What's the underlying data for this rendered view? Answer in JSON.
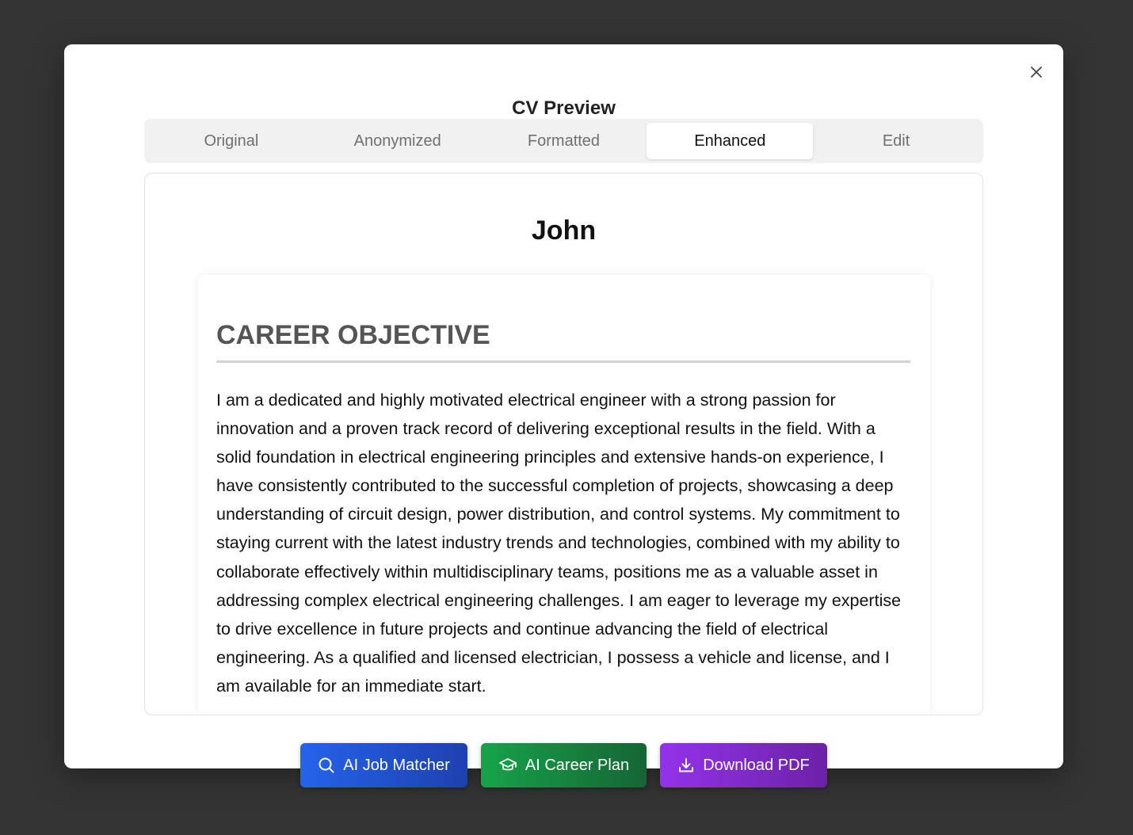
{
  "modal": {
    "title": "CV Preview",
    "close_icon": "close-icon"
  },
  "tabs": [
    {
      "label": "Original"
    },
    {
      "label": "Anonymized"
    },
    {
      "label": "Formatted"
    },
    {
      "label": "Enhanced",
      "active": true
    },
    {
      "label": "Edit"
    }
  ],
  "cv": {
    "name": "John",
    "section_title": "CAREER OBJECTIVE",
    "section_text": "I am a dedicated and highly motivated electrical engineer with a strong passion for innovation and a proven track record of delivering exceptional results in the field. With a solid foundation in electrical engineering principles and extensive hands-on experience, I have consistently contributed to the successful completion of projects, showcasing a deep understanding of circuit design, power distribution, and control systems. My commitment to staying current with the latest industry trends and technologies, combined with my ability to collaborate effectively within multidisciplinary teams, positions me as a valuable asset in addressing complex electrical engineering challenges. I am eager to leverage my expertise to drive excellence in future projects and continue advancing the field of electrical engineering. As a qualified and licensed electrician, I possess a vehicle and license, and I am available for an immediate start."
  },
  "actions": {
    "job_matcher": {
      "label": "AI Job Matcher",
      "icon": "search-icon",
      "color": "#2563eb"
    },
    "career_plan": {
      "label": "AI Career Plan",
      "icon": "graduation-cap-icon",
      "color": "#16a34a"
    },
    "download": {
      "label": "Download PDF",
      "icon": "download-icon",
      "color": "#9333ea"
    }
  }
}
